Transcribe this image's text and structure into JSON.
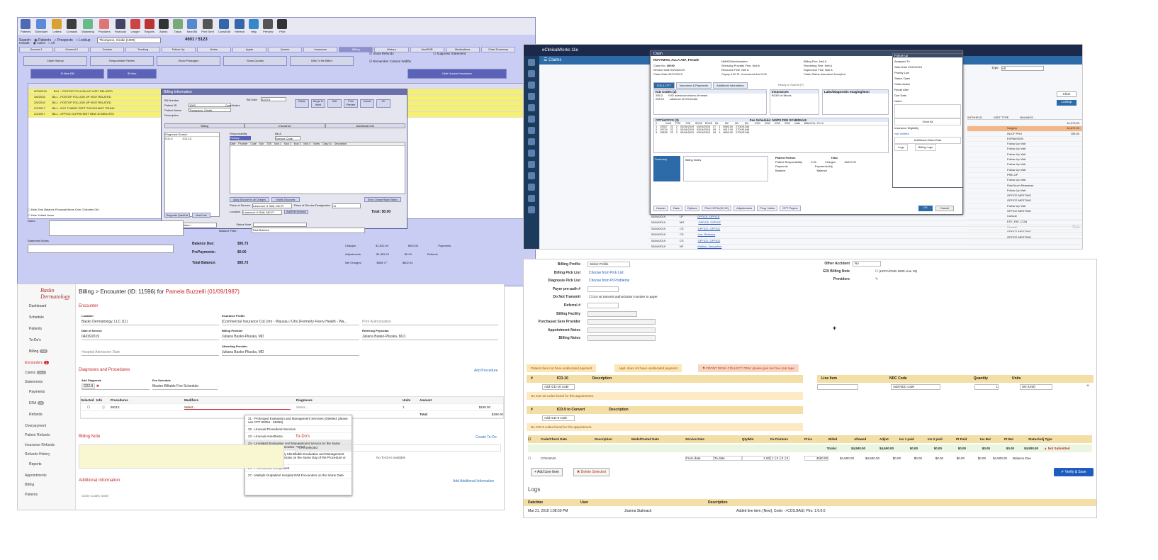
{
  "panel1": {
    "toolbar": [
      "Patients",
      "Scheduler",
      "Letters",
      "Contacts",
      "Marketing",
      "Providers",
      "Financial",
      "Ledger",
      "Reports",
      "Admin",
      "Tasks",
      "New Bill",
      "Print Stmt",
      "Cons/Edit",
      "Refresh",
      "Help",
      "Preview",
      "Print"
    ],
    "search_label": "Search:",
    "include_label": "Include:",
    "radio_patients": "Patients",
    "radio_prospects": "Prospects",
    "radio_all": "All",
    "radio_active": "Active",
    "radio_lookup": "Lookup",
    "patient_combo": "Thompson, Cindie (1000)",
    "record_counter": "4601 / 5123",
    "tabs": [
      "General 1",
      "General 2",
      "Custom",
      "Tracking",
      "Follow Up",
      "Notes",
      "Appts",
      "Quotes",
      "Insurance",
      "Billing",
      "History",
      "NexEMR",
      "Medications",
      "Chart Summary"
    ],
    "buttons": [
      "Claim History",
      "Responsible Parties",
      "Show Packages",
      "Show Quotes",
      "Bills To Be Billed"
    ],
    "chk_refunds": "Show Refunds",
    "chk_column": "Remember Column Widths",
    "chk_suppress": "Suppress Statement",
    "new_bill": "New Bill",
    "new_b2": "New",
    "hide_unused": "Hide Unused Insurance",
    "rows": [
      {
        "date": "5/23/2019",
        "desc": "BILL - POSTOP FOLLOW UP VISIT RELATED"
      },
      {
        "date": "3/6/2018",
        "desc": "BILL - POSTOP FOLLOW UP VISIT RELATED"
      },
      {
        "date": "2/5/2018",
        "desc": "BILL - POSTOP FOLLOW UP VISIT RELATED"
      },
      {
        "date": "2/2/2017",
        "desc": "BILL - EXC TUMOR SOFT TIS INCHANT TRUNK"
      },
      {
        "date": "2/2/2017",
        "desc": "BILL - OFFICE OUTPATIENT NEW 30 MINUTES"
      }
    ],
    "dialog_title": "Billing Information",
    "dlg_bill_number": "Bill Number",
    "dlg_patient_id": "Patient ID",
    "dlg_patient_name": "Patient Name",
    "dlg_description": "Description",
    "dlg_patient_name_val": "Thompson, Cindie",
    "dlg_patient_id_val": "1000",
    "dlg_bill_date": "Bill Date",
    "dlg_bill_date_val": "5/2019",
    "dlg_coord": "Coordinator",
    "dlg_buttons": [
      "Delete",
      "Merge To Word",
      "Edit",
      "Print Preview",
      "Cancel",
      "OK"
    ],
    "dlg_tabs": [
      "Billing",
      "Insurance",
      "Additional Info"
    ],
    "dlg_dx_search": "Diagnosis Search",
    "dlg_icd9": "ICD-9",
    "dlg_icd10": "ICD-10",
    "dlg_responsibility": "Responsibility",
    "dlg_resp_val": "Primary",
    "dlg_bill_as": "Bill A",
    "dlg_bill_as_val": "Service Code",
    "dlg_grid_cols": [
      "Date",
      "Provider",
      "Code",
      "Sub",
      "TOS",
      "Mod 1",
      "Mod 2",
      "Mod 3",
      "Mod 4",
      "Notes",
      "Diag Cs",
      "Description"
    ],
    "dlg_apply_disc": "Apply Discount to all Charges",
    "dlg_modify_disc": "Modify Discounts",
    "dlg_show_batch": "Show Charge Batch Status",
    "dlg_place_label": "Place of Service",
    "dlg_place_val": "Lawrence H Sbitl, MD Pl",
    "dlg_pos_designation": "Place of Service Designation",
    "dlg_pos_val": "11",
    "dlg_location": "Location",
    "dlg_location_val": "Lawrence H Sbitl, MD Pl",
    "dlg_addedit": "Add/Edit Services",
    "dlg_total": "Total:  $0.00",
    "dlg_dx_quicklist": "Diagnosis QuickList",
    "dlg_new_code": "NewCode",
    "dlg_status_label": "Status",
    "dlg_status_val": "<No Status>",
    "dlg_status_note": "Status Note",
    "hide_zero": "Hide Zero Balance Financial Items Over 3 Months Old",
    "hide_voided": "Hide Voided Items",
    "notes_label": "Notes",
    "stmt_notes": "Statement Notes",
    "balance_filter": "Balance Filter:",
    "balance_filter_val": "Total Balance",
    "balance_due_label": "Balance Due:",
    "balance_due_val": "$95.73",
    "prepayments_label": "PrePayments:",
    "prepayments_val": "$0.00",
    "total_balance_label": "Total Balance:",
    "total_balance_val": "$95.73",
    "charges_label": "Charges",
    "charges_a": "$1,810.00",
    "charges_b": "$902.04",
    "payments_label": "Payments",
    "adjustments_label": "Adjustments",
    "adj_a": "$1,581.23",
    "adj_b": "$0.00",
    "refunds_label": "Refunds",
    "net_label": "Net Charges",
    "net_a": "$598.77",
    "net_b": "$802.04"
  },
  "panel2": {
    "brand": "eClinicalWorks 11e",
    "header": "Claims",
    "claim_title": "Claim",
    "patient": "ROYTMAN, ALLA A87, Female",
    "claim_no_label": "Claim No:",
    "claim_no": "49190",
    "appt_facility": "NMHD/Northwestern",
    "service_date_label": "Service Date",
    "service_date": "03/04/2019",
    "claim_date_label": "Claim Date",
    "claim_date": "02/27/2019",
    "serv_provider_label": "Servicing Provider",
    "serv_provider": "Fine, Neil A",
    "billing_label": "Billing",
    "billing": "Fine, Neil A",
    "rendering_label": "Rendering",
    "rendering": "Fine, Neil A",
    "supervisor_label": "Supervisor",
    "supervisor": "Fine, Neil A",
    "resource_label": "Resource",
    "resource": "Fine, Neil A",
    "claim_status_label": "Claim Status",
    "claim_status": "Insurance Accepted",
    "copay_label": "Copay",
    "copay": "0.00",
    "pt_uncovered_label": "Pt. Uncovered Amt",
    "pt_uncovered": "0.00",
    "tabs": [
      "ICD & CPT",
      "Insurance & Payments",
      "Additional Information"
    ],
    "ready_text": "Ready to Submit (P)",
    "icd_header": "ICD Codes (2)",
    "icd_rows": [
      {
        "code": "285.3",
        "name": "IVIG adenocarcinoma of breast"
      },
      {
        "code": "298.12",
        "name": "Absence of left breast"
      }
    ],
    "ins_header": "Insurances",
    "ins_val": "BCBS of Illinois",
    "labs_header": "Labs/Diagnostic Imaging/Imm",
    "cpt_header": "CPT/HCPCS (3)",
    "fee_schedule": "Fee Schedule:",
    "fee_val": "NGPS FEE SCHEDULE",
    "cpt_cols": [
      "#",
      "Code",
      "POS",
      "TOS",
      "SDOS",
      "EDOS",
      "M1",
      "M2",
      "M3",
      "M4",
      "ICD1",
      "ICD2",
      "ICD3",
      "ICD4",
      "Units",
      "Billed Fee",
      "Pvr Id"
    ],
    "cpt_rows": [
      {
        "n": "1",
        "code": "19357",
        "pos": "22",
        "tos": "2",
        "sdos": "03/04/2019",
        "edos": "03/04/2019",
        "m1": "LT",
        "units": "1",
        "fee": "6960.00",
        "pvr": "270491346"
      },
      {
        "n": "2",
        "code": "15734",
        "pos": "22",
        "tos": "2",
        "sdos": "03/04/2019",
        "edos": "03/04/2019",
        "m1": "59",
        "units": "1",
        "fee": "6912.00",
        "pvr": "270491346"
      },
      {
        "n": "3",
        "code": "15825",
        "pos": "22",
        "tos": "2",
        "sdos": "03/04/2019",
        "edos": "03/04/2019",
        "m1": "59",
        "units": "1",
        "fee": "6600.00",
        "pvr": "270491346"
      }
    ],
    "summary_label": "Summary",
    "billing_notes": "Billing Notes",
    "patient_portion": "Patient Portion",
    "total_label": "Total",
    "pr_resp": "Patient Responsibility",
    "pr_payments": "Payments",
    "pr_balance": "Balance",
    "charges_label": "Charges",
    "charges_val": "16872.00",
    "payments_adj": "Payments/Adj",
    "zero": "0.00",
    "footer_btns": [
      "Header",
      "Data",
      "Options",
      "Print HCFA (02-12)",
      "Adjustments",
      "Prog. Notes",
      "CPT Payers"
    ],
    "ok": "OK",
    "cancel": "Cancel",
    "followup_title": "Follow up",
    "fu_assigned": "Assigned To",
    "fu_start": "Start Date",
    "fu_start_val": "03/21/2019",
    "fu_priority": "Priority",
    "fu_priority_val": "Low",
    "fu_status": "Status",
    "fu_status_val": "Open",
    "fu_action": "Claim Action",
    "fu_recall": "Recall After",
    "fu_due": "Due Date",
    "fu_notes": "Notes",
    "fu_clear": "Clear All",
    "fu_elig": "Insurance Eligibility",
    "fu_notverified": "Not Verified",
    "fu_addl": "Additional Claim Data",
    "fu_logs": "Logs",
    "fu_billing_logs": "Billing Logs",
    "right_cols": [
      "WITHHELD",
      "VISIT TYPE",
      "BALANCE"
    ],
    "right_rows": [
      {
        "type": "",
        "bal": "12,073.00"
      },
      {
        "type": "Surgery",
        "bal": "16,872.00"
      },
      {
        "type": "INJCF PRO",
        "bal": "155.00"
      },
      {
        "type": "EXPANSION",
        "bal": ""
      },
      {
        "type": "Follow Up Visit",
        "bal": ""
      },
      {
        "type": "Follow Up Visit",
        "bal": ""
      },
      {
        "type": "Follow Up Visit",
        "bal": ""
      },
      {
        "type": "Follow Up Visit",
        "bal": ""
      },
      {
        "type": "Follow Up Visit",
        "bal": ""
      },
      {
        "type": "Follow Up Visit",
        "bal": ""
      },
      {
        "type": "PRE-OP",
        "bal": ""
      },
      {
        "type": "Follow Up Visit",
        "bal": ""
      },
      {
        "type": "PainTouch Reassess",
        "bal": ""
      },
      {
        "type": "Follow Up Visit",
        "bal": ""
      },
      {
        "type": "OFFICE MEETING",
        "bal": ""
      },
      {
        "type": "OFFICE MEETING",
        "bal": ""
      },
      {
        "type": "Follow Up Visit",
        "bal": ""
      },
      {
        "type": "OFFICE MEETING",
        "bal": ""
      },
      {
        "type": "Consult",
        "bal": ""
      },
      {
        "type": "EST_PAT_CON",
        "bal": ""
      },
      {
        "type": "Consult",
        "bal": "75.00"
      },
      {
        "type": "OFFICE MEETING",
        "bal": ""
      },
      {
        "type": "OFFICE MEETING",
        "bal": ""
      }
    ],
    "list_rows": [
      {
        "date": "03/04/2019",
        "pos": "LP",
        "name": "OFFICE, OFFICE"
      },
      {
        "date": "03/04/2019",
        "pos": "MG",
        "name": "OFFICE, OFFICE"
      },
      {
        "date": "03/04/2019",
        "pos": "CS",
        "name": "OFFICE, OFFICE"
      },
      {
        "date": "03/04/2019",
        "pos": "CS",
        "name": "Lee, Rebecca"
      },
      {
        "date": "03/04/2019",
        "pos": "CS",
        "name": "OFFICE, OFFICE"
      },
      {
        "date": "03/04/2019",
        "pos": "NF",
        "name": "Mallory, Jacqueline"
      },
      {
        "date": "03/04/2019",
        "pos": "MG",
        "name": "Anderson, Barbara"
      },
      {
        "date": "03/04/2019",
        "pos": "CS",
        "name": "Hagan, Mary Lou"
      }
    ],
    "consult_patient": "Patient",
    "consult_amt1": "$85.00",
    "consult_amt2": "$10.00",
    "clear": "Clear",
    "lookup": "Lookup",
    "type_label": "Type",
    "type_val": "All"
  },
  "panel3": {
    "logo": "Basko Dermatology",
    "nav": [
      {
        "label": "Dashboard"
      },
      {
        "label": "Schedule"
      },
      {
        "label": "Patients"
      },
      {
        "label": "To-Do's"
      },
      {
        "label": "Billing",
        "badge": "230"
      },
      {
        "label": "Encounters",
        "badge": "1",
        "sub": true,
        "active": true
      },
      {
        "label": "Claims",
        "badge": "1104",
        "sub": true
      },
      {
        "label": "Statements",
        "sub": true
      },
      {
        "label": "Payments"
      },
      {
        "label": "ERA",
        "badge": "25"
      },
      {
        "label": "Refunds"
      },
      {
        "label": "Overpayment",
        "sub": true
      },
      {
        "label": "Patient Refunds",
        "sub": true
      },
      {
        "label": "Insurance Refunds",
        "sub": true
      },
      {
        "label": "Refunds History",
        "sub": true
      },
      {
        "label": "Reports"
      },
      {
        "label": "Appointments",
        "sub": true
      },
      {
        "label": "Billing",
        "sub": true
      },
      {
        "label": "Patients",
        "sub": true
      }
    ],
    "title_prefix": "Billing > Encounter (ID: 11596) for",
    "title_patient": "Pamela Buzzelli (01/09/1987)",
    "encounter": "Encounter",
    "location_label": "Location",
    "location_val": "Basko Dermatology, LLC (11)",
    "ins_label": "Insurance Profile",
    "ins_val": "[Commercial Insurance Co] Umr - Wausau / Uhs (Formerly Fiserv Health - Wa...",
    "prior_auth": "Prior Authorization",
    "dos_label": "Date of Service",
    "dos_val": "04/03/2019",
    "billing_provider_label": "Billing Provider",
    "billing_provider_val": "Juliana Basko-Pliuska, MD",
    "referring_label": "Referring Physician",
    "referring_val": "Juliana Basko-Pliuska, M.D.",
    "attending_label": "Attending Provider",
    "attending_val": "Juliana Basko-Pliuska, MD",
    "hospital_admission": "Hospital Admission Date",
    "diag_proc": "Diagnoses and Procedures",
    "add_procedure": "Add Procedure",
    "add_diagnosis": "Add Diagnosis",
    "diag_chip": "D22.9",
    "fee_schedule": "Fee Schedule",
    "fee_schedule_val": "Master Billable Fee Schedule",
    "proc_cols": [
      "Selected",
      "Info",
      "Procedures",
      "Modifiers",
      "Diagnoses",
      "Units",
      "Amount"
    ],
    "proc_code": "99213",
    "modifier_placeholder": "Select...",
    "diag_placeholder": "Select...",
    "units": "1",
    "amount": "$198.00",
    "total_label": "Total:",
    "total_val": "$198.00",
    "dropdown": [
      "21 - Prolonged Evaluation and Management Services (Deleted, please use CPT 99354 - 99359)",
      "22 - Unusual Procedural Services",
      "23 - Unusual Anesthesia",
      "24 - Unrelated Evaluation and Management Service by the Same Physician during a Postoperative Period",
      "25 - Significant, Separately Identifiable Evaluation and Management Service by the Same Physician on the Same Day of the Procedure or Other Service",
      "26 - Professional Component",
      "27 - Multiple Outpatient Hospital E/M Encounters on the Same Date"
    ],
    "billing_note": "Billing Note",
    "todos": "To-Do's",
    "create_todo": "Create To-Do",
    "selected_count": "0 selected",
    "no_todos": "No To-Do's available",
    "additional_info": "Additional Information",
    "add_additional": "Add Additional Information",
    "claim_codes": "Claim Codes (10D)"
  },
  "panel4": {
    "fields": [
      {
        "label": "Billing Profile",
        "val": "Select Profile"
      },
      {
        "label": "Billing Pick List",
        "val": "Choose from Pick List",
        "link": true
      },
      {
        "label": "Diagnosis Pick List",
        "val": "Choose from Pt Problems",
        "link": true
      },
      {
        "label": "Payer pre-auth #",
        "val": ""
      },
      {
        "label": "Do Not Transmit",
        "val": "Do not transmit authorization number to payer"
      },
      {
        "label": "Referral #",
        "val": ""
      },
      {
        "label": "Billing Facility",
        "val": ""
      },
      {
        "label": "Purchased Serv Provider",
        "val": ""
      },
      {
        "label": "Appointment Notes",
        "val": ""
      },
      {
        "label": "Billing Notes",
        "val": ""
      }
    ],
    "other_accident": "Other Accident",
    "other_accident_val": "No",
    "edi_billing": "EDI Billing Note",
    "edi_val": "(HCFA/CMS-1500 Line 19)",
    "providers": "Providers",
    "alert1": "Patient does not have unallocated payment",
    "alert2": "Appt. does not have unallocated payment",
    "alert3": "FRONT DESK COLLECT ITEM: please give her free scar tape",
    "icd10_header": "ICD-10",
    "icd10_desc": "Description",
    "icd10_placeholder": "Add ICD-10 code",
    "icd10_empty": "No ICD-10 codes found for this appointment.",
    "lineitem_header": "Line Item",
    "ndc_header": "NDC Code",
    "qty_header": "Quantity",
    "units_header": "Units",
    "ndc_placeholder": "Add NDC code",
    "qty_val": "1",
    "units_val": "UN (Unit)",
    "icd9_header": "ICD-9 to Convert",
    "icd9_desc": "Description",
    "icd9_placeholder": "Add ICD-9 code",
    "icd9_empty": "No ICD-9 codes found for this appointment.",
    "li_cols": [
      "Code/Check Date",
      "Description",
      "Mods/Posted Date",
      "Service Date",
      "Qty/Min",
      "Dx Pointers",
      "Price",
      "Billed",
      "Allowed",
      "Adjmt",
      "Ins 1 paid",
      "Ins 2 paid",
      "Pt Paid",
      "Ins Bal",
      "Pt Bal",
      "Status/Adj Type"
    ],
    "totals_label": "Totals:",
    "totals": [
      "$4,500.00",
      "$4,500.00",
      "$0.00",
      "$0.00",
      "$0.00",
      "$0.00",
      "$0.00",
      "$4,500.00"
    ],
    "not_submitted": "Not Submitted",
    "line_code": "COS.BASI",
    "from_date": "From date",
    "to_date": "To date",
    "qty": "1.00",
    "dx": [
      "1",
      "0",
      "0",
      "0"
    ],
    "price": "4500.00",
    "line_vals": [
      "$4,500.00",
      "$4,500.00",
      "$0.00",
      "$0.00",
      "$0.00",
      "$0.00",
      "$0.00",
      "$4,500.00"
    ],
    "balance_due": "Balance Due",
    "add_line": "+ Add Line Item",
    "delete_sel": "✖ Delete Selected",
    "verify_save": "✔ Verify & Save",
    "logs_title": "Logs",
    "log_cols": [
      "Datetime",
      "User",
      "Description"
    ],
    "log_row": {
      "dt": "Mar 21, 2019 1:08:50 PM",
      "user": "Joanna Stalmack",
      "desc": "Added line item: [New]; Code: ->COS.BASI; Ptrs: 1:0:0:0"
    }
  },
  "colors": {
    "p1_bg": "#c9cdf3",
    "p2_bar": "#1b2a4a",
    "p3_accent": "#c62828",
    "p4_header": "#f3dea5",
    "verify": "#1f5cbf"
  }
}
